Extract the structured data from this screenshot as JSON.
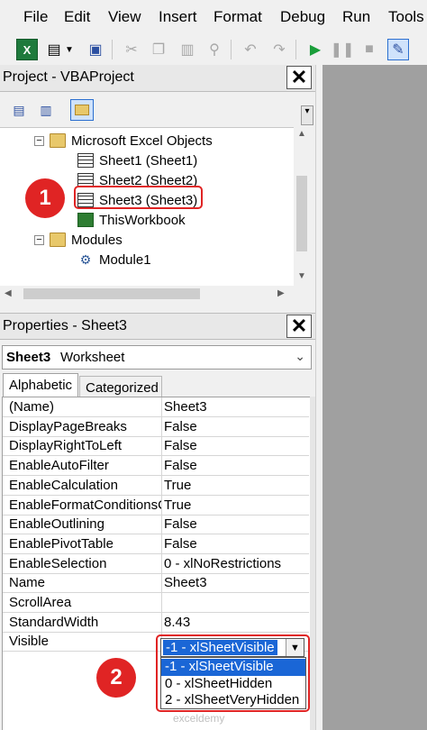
{
  "menu": [
    "File",
    "Edit",
    "View",
    "Insert",
    "Format",
    "Debug",
    "Run",
    "Tools"
  ],
  "project": {
    "title": "Project - VBAProject",
    "tree": {
      "excel_objects": "Microsoft Excel Objects",
      "sheet1": "Sheet1 (Sheet1)",
      "sheet2": "Sheet2 (Sheet2)",
      "sheet3": "Sheet3 (Sheet3)",
      "workbook": "ThisWorkbook",
      "modules": "Modules",
      "module1": "Module1"
    }
  },
  "properties": {
    "title": "Properties - Sheet3",
    "object_name": "Sheet3",
    "object_type": "Worksheet",
    "tabs": [
      "Alphabetic",
      "Categorized"
    ],
    "rows": [
      {
        "name": "(Name)",
        "value": "Sheet3"
      },
      {
        "name": "DisplayPageBreaks",
        "value": "False"
      },
      {
        "name": "DisplayRightToLeft",
        "value": "False"
      },
      {
        "name": "EnableAutoFilter",
        "value": "False"
      },
      {
        "name": "EnableCalculation",
        "value": "True"
      },
      {
        "name": "EnableFormatConditionsC",
        "value": "True"
      },
      {
        "name": "EnableOutlining",
        "value": "False"
      },
      {
        "name": "EnablePivotTable",
        "value": "False"
      },
      {
        "name": "EnableSelection",
        "value": "0 - xlNoRestrictions"
      },
      {
        "name": "Name",
        "value": "Sheet3"
      },
      {
        "name": "ScrollArea",
        "value": ""
      },
      {
        "name": "StandardWidth",
        "value": "8.43"
      },
      {
        "name": "Visible",
        "value": ""
      }
    ],
    "visible_selected": "-1 - xlSheetVisible",
    "visible_options": [
      "-1 - xlSheetVisible",
      "0 - xlSheetHidden",
      "2 - xlSheetVeryHidden"
    ]
  },
  "callouts": {
    "one": "1",
    "two": "2"
  },
  "watermark": "exceldemy",
  "colors": {
    "highlight": "#e02424",
    "selection": "#1a66d6"
  }
}
